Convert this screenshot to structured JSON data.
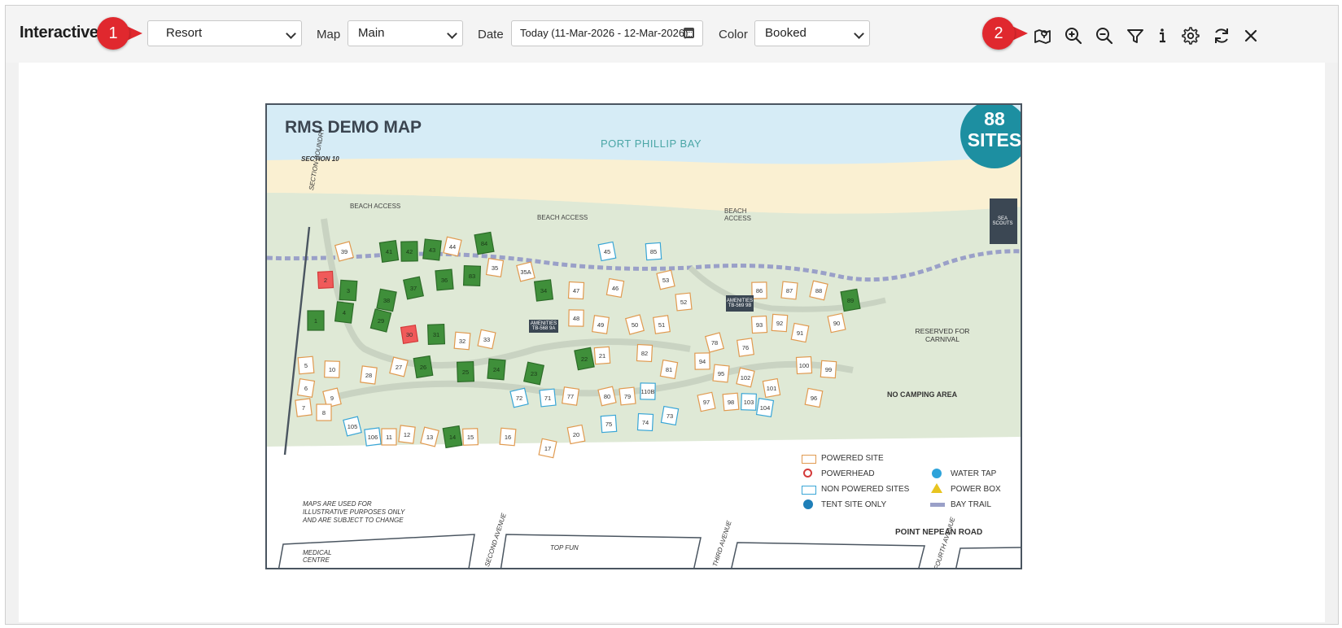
{
  "toolbar": {
    "title": "Interactive",
    "callout_1": "1",
    "callout_2": "2",
    "property_select": "Resort",
    "map_label": "Map",
    "map_select": "Main",
    "date_label": "Date",
    "date_value": "Today (11-Mar-2026 - 12-Mar-2026)",
    "color_label": "Color",
    "color_select": "Booked",
    "tools": [
      "map-icon",
      "zoom-in-icon",
      "zoom-out-icon",
      "filter-icon",
      "info-icon",
      "settings-icon",
      "refresh-icon",
      "close-icon"
    ]
  },
  "map": {
    "title": "RMS DEMO MAP",
    "bay": "PORT PHILLIP BAY",
    "badge_number": "88",
    "badge_text": "SITES",
    "section_10": "SECTION 10",
    "section_boundry": "SECTION BOUNDRY",
    "beach_access": "BEACH ACCESS",
    "sea_scouts": "SEA SCOUTS",
    "amenities_1": "AMENITIES TB-568 9A",
    "amenities_2": "AMENITIES TB-569 9B",
    "reserved": "RESERVED FOR CARNIVAL",
    "no_camping": "NO CAMPING AREA",
    "disclaimer": "MAPS ARE USED FOR ILLUSTRATIVE PURPOSES ONLY AND ARE SUBJECT TO CHANGE",
    "road": "POINT NEPEAN ROAD",
    "streets": [
      "MEDICAL CENTRE",
      "SECOND AVENUE",
      "TOP FUN",
      "THIRD AVENUE",
      "FOURTH AVENUE"
    ],
    "legend": {
      "powered_site": "POWERED SITE",
      "powerhead": "POWERHEAD",
      "non_powered": "NON POWERED SITES",
      "tent_site": "TENT SITE ONLY",
      "water_tap": "WATER TAP",
      "power_box": "POWER BOX",
      "bay_trail": "BAY TRAIL"
    },
    "colors": {
      "booked": "#3f8f3a",
      "selected": "#f05a5a",
      "powered": "#e09a50",
      "non_powered": "#3aa6d6",
      "sea": "#d6ecf6",
      "sand": "#faf0d2",
      "grass": "#dfe9d6",
      "trail": "#9aa0c8",
      "badge": "#1d8fa1"
    },
    "sites": [
      {
        "id": "39",
        "status": "powered"
      },
      {
        "id": "41",
        "status": "booked"
      },
      {
        "id": "42",
        "status": "booked"
      },
      {
        "id": "43",
        "status": "booked"
      },
      {
        "id": "44",
        "status": "powered"
      },
      {
        "id": "84",
        "status": "booked"
      },
      {
        "id": "2",
        "status": "selected"
      },
      {
        "id": "3",
        "status": "booked"
      },
      {
        "id": "38",
        "status": "booked"
      },
      {
        "id": "37",
        "status": "booked"
      },
      {
        "id": "36",
        "status": "booked"
      },
      {
        "id": "83",
        "status": "booked"
      },
      {
        "id": "35",
        "status": "powered"
      },
      {
        "id": "35A",
        "status": "powered"
      },
      {
        "id": "34",
        "status": "booked"
      },
      {
        "id": "1",
        "status": "booked"
      },
      {
        "id": "4",
        "status": "booked"
      },
      {
        "id": "29",
        "status": "booked"
      },
      {
        "id": "30",
        "status": "selected"
      },
      {
        "id": "31",
        "status": "booked"
      },
      {
        "id": "32",
        "status": "powered"
      },
      {
        "id": "33",
        "status": "powered"
      },
      {
        "id": "45",
        "status": "non_powered"
      },
      {
        "id": "85",
        "status": "non_powered"
      },
      {
        "id": "47",
        "status": "powered"
      },
      {
        "id": "46",
        "status": "powered"
      },
      {
        "id": "53",
        "status": "powered"
      },
      {
        "id": "52",
        "status": "powered"
      },
      {
        "id": "48",
        "status": "powered"
      },
      {
        "id": "49",
        "status": "powered"
      },
      {
        "id": "50",
        "status": "powered"
      },
      {
        "id": "51",
        "status": "powered"
      },
      {
        "id": "86",
        "status": "powered"
      },
      {
        "id": "87",
        "status": "powered"
      },
      {
        "id": "88",
        "status": "powered"
      },
      {
        "id": "89",
        "status": "booked"
      },
      {
        "id": "93",
        "status": "powered"
      },
      {
        "id": "92",
        "status": "powered"
      },
      {
        "id": "91",
        "status": "powered"
      },
      {
        "id": "90",
        "status": "powered"
      },
      {
        "id": "5",
        "status": "powered"
      },
      {
        "id": "10",
        "status": "powered"
      },
      {
        "id": "6",
        "status": "powered"
      },
      {
        "id": "9",
        "status": "powered"
      },
      {
        "id": "7",
        "status": "powered"
      },
      {
        "id": "8",
        "status": "powered"
      },
      {
        "id": "28",
        "status": "powered"
      },
      {
        "id": "27",
        "status": "powered"
      },
      {
        "id": "26",
        "status": "booked"
      },
      {
        "id": "25",
        "status": "booked"
      },
      {
        "id": "24",
        "status": "booked"
      },
      {
        "id": "23",
        "status": "booked"
      },
      {
        "id": "22",
        "status": "booked"
      },
      {
        "id": "21",
        "status": "powered"
      },
      {
        "id": "82",
        "status": "powered"
      },
      {
        "id": "81",
        "status": "powered"
      },
      {
        "id": "80",
        "status": "powered"
      },
      {
        "id": "79",
        "status": "powered"
      },
      {
        "id": "110B",
        "status": "non_powered"
      },
      {
        "id": "77",
        "status": "powered"
      },
      {
        "id": "78",
        "status": "powered"
      },
      {
        "id": "76",
        "status": "powered"
      },
      {
        "id": "94",
        "status": "powered"
      },
      {
        "id": "95",
        "status": "powered"
      },
      {
        "id": "102",
        "status": "powered"
      },
      {
        "id": "101",
        "status": "powered"
      },
      {
        "id": "100",
        "status": "powered"
      },
      {
        "id": "99",
        "status": "powered"
      },
      {
        "id": "96",
        "status": "powered"
      },
      {
        "id": "97",
        "status": "powered"
      },
      {
        "id": "98",
        "status": "powered"
      },
      {
        "id": "103",
        "status": "non_powered"
      },
      {
        "id": "104",
        "status": "non_powered"
      },
      {
        "id": "105",
        "status": "non_powered"
      },
      {
        "id": "106",
        "status": "non_powered"
      },
      {
        "id": "11",
        "status": "powered"
      },
      {
        "id": "12",
        "status": "powered"
      },
      {
        "id": "13",
        "status": "powered"
      },
      {
        "id": "14",
        "status": "booked"
      },
      {
        "id": "15",
        "status": "powered"
      },
      {
        "id": "16",
        "status": "powered"
      },
      {
        "id": "17",
        "status": "powered"
      },
      {
        "id": "20",
        "status": "powered"
      },
      {
        "id": "75",
        "status": "non_powered"
      },
      {
        "id": "74",
        "status": "non_powered"
      },
      {
        "id": "73",
        "status": "non_powered"
      },
      {
        "id": "72",
        "status": "non_powered"
      },
      {
        "id": "71",
        "status": "non_powered"
      }
    ]
  }
}
